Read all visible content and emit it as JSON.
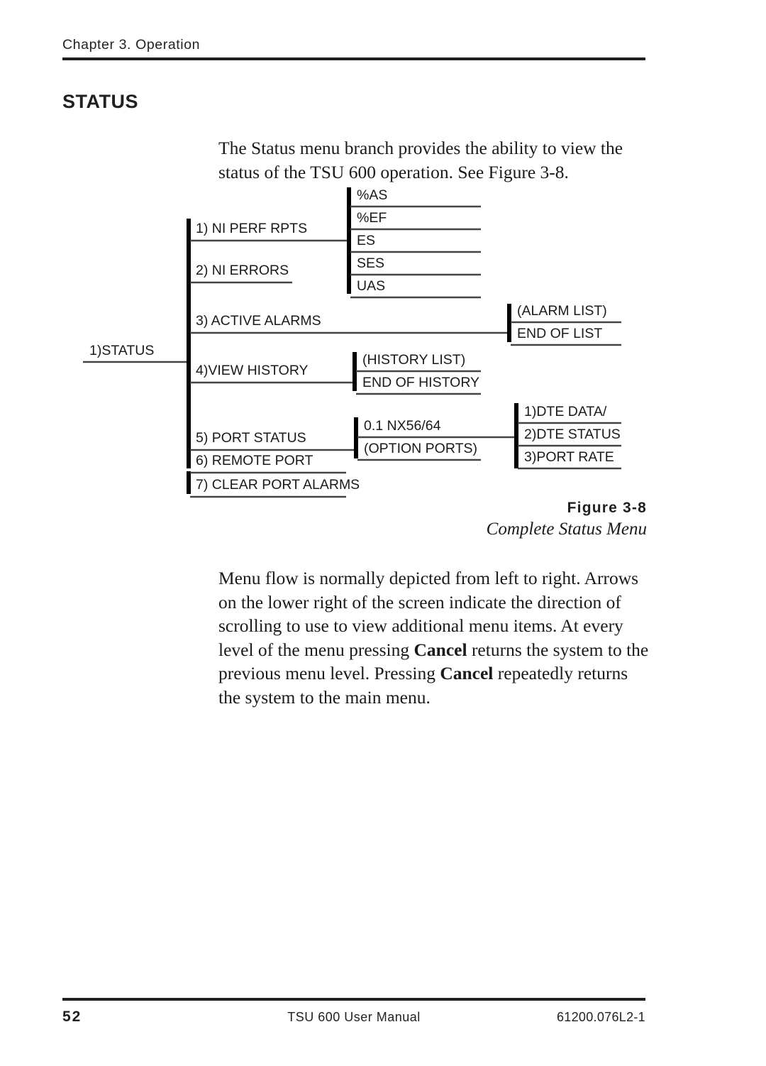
{
  "header": {
    "chapter": "Chapter 3.  Operation"
  },
  "section": {
    "heading": "STATUS"
  },
  "paragraphs": {
    "intro": "The Status menu branch provides the ability to view the status of the TSU 600 operation.  See Figure 3-8.",
    "flow_part1": "Menu flow is normally depicted from left to right.  Arrows on the lower right of the screen indicate the direction of scrolling to use to view additional menu items.  At every level of the menu pressing ",
    "flow_bold1": "Cancel",
    "flow_part2": " returns the system to the previous menu level.  Pressing ",
    "flow_bold2": "Cancel",
    "flow_part3": " repeatedly returns the system to the main menu."
  },
  "figure": {
    "number": "Figure 3-8",
    "title": "Complete Status Menu"
  },
  "diagram": {
    "root": "1)STATUS",
    "level1": [
      "1) NI PERF RPTS",
      "2) NI ERRORS",
      "3) ACTIVE ALARMS",
      "4)VIEW HISTORY",
      "5) PORT STATUS",
      "6) REMOTE PORT",
      "7) CLEAR PORT ALARMS"
    ],
    "perf_reports": [
      "%AS",
      "%EF",
      "ES",
      "SES",
      "UAS"
    ],
    "alarm_group": [
      "(ALARM LIST)",
      "END OF LIST"
    ],
    "history_group": [
      "(HISTORY LIST)",
      "END OF HISTORY"
    ],
    "port_group": [
      "0.1 NX56/64",
      "(OPTION PORTS)"
    ],
    "dte_group": [
      "1)DTE DATA/",
      "2)DTE STATUS",
      "3)PORT RATE"
    ]
  },
  "footer": {
    "page_number": "52",
    "manual_title": "TSU 600 User Manual",
    "doc_number": "61200.076L2-1"
  }
}
